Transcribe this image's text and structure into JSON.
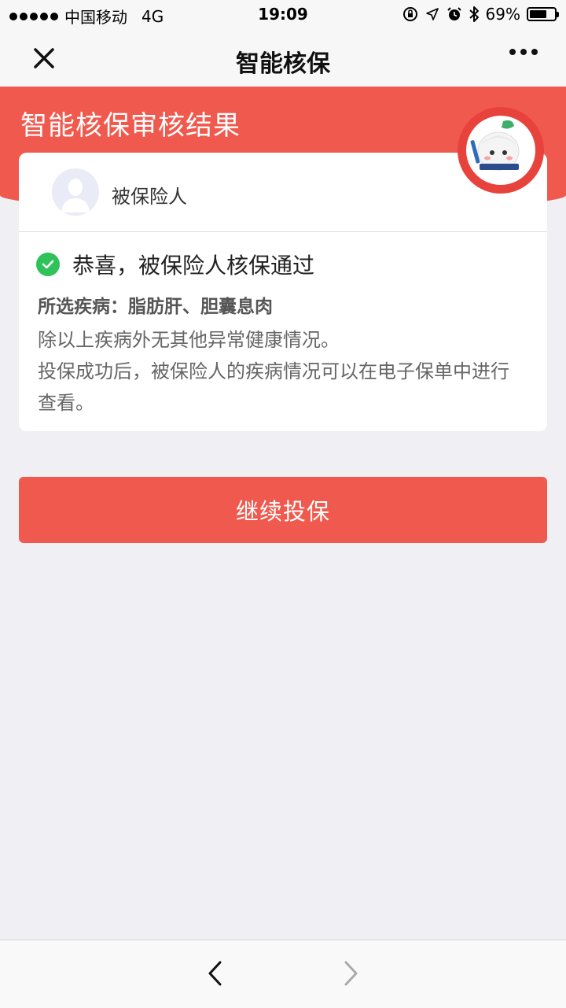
{
  "status_bar": {
    "carrier": "中国移动",
    "network": "4G",
    "time": "19:09",
    "battery_percent": "69%",
    "battery_level": 0.69,
    "icons": [
      "signal-dots-icon",
      "rotation-lock-icon",
      "location-icon",
      "alarm-icon",
      "bluetooth-icon",
      "battery-icon"
    ]
  },
  "nav": {
    "title": "智能核保",
    "close_icon": "close-icon",
    "more_icon": "more-icon"
  },
  "header": {
    "title": "智能核保审核结果",
    "mascot_icon": "mascot-icon"
  },
  "card": {
    "person_label": "被保险人",
    "avatar_icon": "avatar-icon",
    "result_text": "恭喜，被保险人核保通过",
    "disease_line": "所选疾病：脂肪肝、胆囊息肉",
    "desc_1": "除以上疾病外无其他异常健康情况。",
    "desc_2": "投保成功后，被保险人的疾病情况可以在电子保单中进行查看。"
  },
  "button": {
    "label": "继续投保"
  },
  "bottom_bar": {
    "back_icon": "back-arrow-icon",
    "forward_icon": "forward-arrow-icon"
  },
  "colors": {
    "accent": "#f05a4e",
    "success": "#2fc25b",
    "background": "#efeff4"
  }
}
